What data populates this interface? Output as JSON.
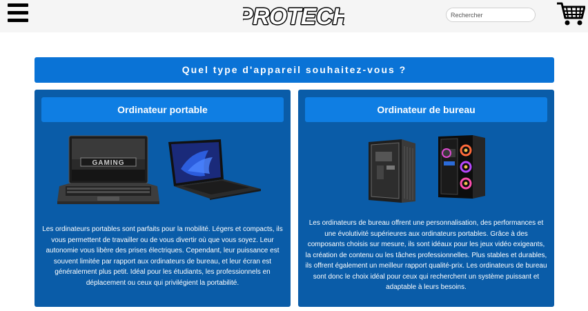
{
  "header": {
    "logo_text": "PROTECH",
    "menu_icon": "hamburger-menu-icon",
    "cart_icon": "shopping-cart-icon",
    "search": {
      "placeholder": "Rechercher",
      "value": ""
    }
  },
  "main": {
    "question": "Quel type d'appareil souhaitez-vous ?",
    "cards": [
      {
        "title": "Ordinateur portable",
        "description": "Les ordinateurs portables sont parfaits pour la mobilité. Légers et compacts, ils vous permettent de travailler ou de vous divertir où que vous soyez. Leur autonomie vous libère des prises électriques. Cependant, leur puissance est souvent limitée par rapport aux ordinateurs de bureau, et leur écran est généralement plus petit. Idéal pour les étudiants, les professionnels en déplacement ou ceux qui privilégient la portabilité.",
        "images": [
          "gaming-laptop-image",
          "laptop-image"
        ]
      },
      {
        "title": "Ordinateur de bureau",
        "description": "Les ordinateurs de bureau offrent une personnalisation, des performances et une évolutivité supérieures aux ordinateurs portables. Grâce à des composants choisis sur mesure, ils sont idéaux pour les jeux vidéo exigeants, la création de contenu ou les tâches professionnelles. Plus stables et durables, ils offrent également un meilleur rapport qualité-prix. Les ordinateurs de bureau sont donc le choix idéal pour ceux qui recherchent un système puissant et adaptable à leurs besoins.",
        "images": [
          "pc-tower-image",
          "rgb-pc-tower-image"
        ]
      }
    ]
  },
  "colors": {
    "topbar": "#f5f5f5",
    "banner": "#0a73d6",
    "card": "#0a5ca8",
    "card_title": "#0f7ee3",
    "logo_blue": "#1257c9",
    "text_on_blue": "#ffffff"
  }
}
